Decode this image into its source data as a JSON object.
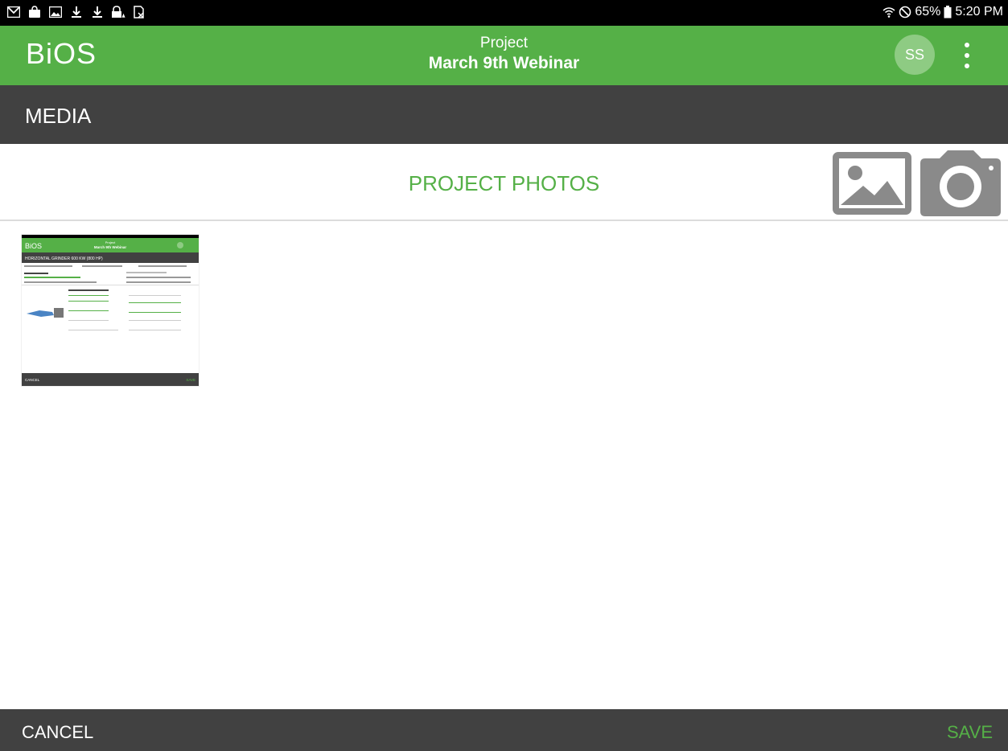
{
  "status_bar": {
    "left_icons": [
      "gmail-icon",
      "shopping-bag-icon",
      "image-icon",
      "download-icon",
      "download-icon",
      "lock-warning-icon",
      "no-sim-icon"
    ],
    "battery": "65%",
    "time": "5:20 PM"
  },
  "app_bar": {
    "logo": "BiOS",
    "subtitle": "Project",
    "title": "March 9th Webinar",
    "avatar_initials": "SS"
  },
  "section": {
    "title": "MEDIA"
  },
  "photos": {
    "heading": "PROJECT PHOTOS",
    "thumbnail": {
      "logo": "BiOS",
      "subtitle": "Project",
      "title": "March 9th Webinar",
      "section": "HORIZONTAL GRINDER 600 KW (800 HP)",
      "cancel": "CANCEL",
      "save": "SAVE"
    }
  },
  "footer": {
    "cancel_label": "CANCEL",
    "save_label": "SAVE"
  },
  "colors": {
    "brand_green": "#55b047",
    "dark_bar": "#414141",
    "icon_gray": "#8a8a8a"
  }
}
